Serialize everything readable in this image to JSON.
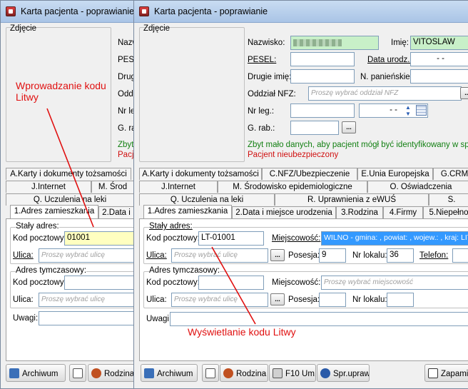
{
  "back_window": {
    "title": "Karta pacjenta - poprawianie",
    "photo_label": "Zdjęcie",
    "labels": {
      "nazwisko": "Nazwis",
      "pesel": "PESE",
      "drugie": "Drugie",
      "oddzial": "Oddzi",
      "nr_leg": "Nr leg",
      "g_rab": "G. rab"
    },
    "msg_green": "Zbyt",
    "msg_red": "Pacjen",
    "tabs_row1": [
      "A.Karty i dokumenty tożsamości",
      ""
    ],
    "tabs_row2": [
      "J.Internet",
      "M. Środ"
    ],
    "tabs_row3": [
      "Q. Uczulenia na leki"
    ],
    "tabs_row4": [
      "1.Adres zamieszkania",
      "2.Data i"
    ],
    "staly_adres": "Stały adres:",
    "kod_pocztowy_label": "Kod pocztowy:",
    "kod_pocztowy_value": "01001",
    "ulica_label": "Ulica:",
    "ulica_placeholder": "Proszę wybrać ulicę",
    "adres_tymczasowy": "Adres tymczasowy:",
    "uwagi_label": "Uwagi:",
    "buttons": {
      "archiwum": "Archiwum",
      "rodzina": "Rodzina"
    }
  },
  "front_window": {
    "title": "Karta pacjenta - poprawianie",
    "photo_label": "Zdjęcie",
    "nazwisko_label": "Nazwisko:",
    "imie_label": "Imię:",
    "imie_value": "VITOSLAW",
    "pesel_label": "PESEL:",
    "data_urodz_label": "Data urodz.:",
    "data_urodz_value": "-   -",
    "drugie_imie_label": "Drugie imię:",
    "n_panienskie_label": "N. panieńskie:",
    "oddzial_label": "Oddział NFZ:",
    "oddzial_placeholder": "Proszę wybrać oddział NFZ",
    "nr_leg_label": "Nr leg.:",
    "nr_leg_date": "-   -",
    "g_rab_label": "G. rab.:",
    "msg_green": "Zbyt mało danych, aby pacjent mógł być identyfikowany w spraw",
    "msg_red": "Pacjent nieubezpieczony",
    "tabs_row1": [
      "A.Karty i dokumenty tożsamości",
      "C.NFZ/Ubezpieczenie",
      "E.Unia Europejska",
      "G.CRM"
    ],
    "tabs_row2": [
      "J.Internet",
      "M. Środowisko epidemiologiczne",
      "O. Oświadczenia"
    ],
    "tabs_row3": [
      "Q. Uczulenia na leki",
      "R. Uprawnienia z eWUŚ",
      "S."
    ],
    "tabs_row4": [
      "1.Adres zamieszkania",
      "2.Data i miejsce urodzenia",
      "3.Rodzina",
      "4.Firmy",
      "5.Niepełno"
    ],
    "staly_adres": "Stały adres:",
    "kod_pocztowy_label": "Kod pocztowy:",
    "kod_pocztowy_value": "LT-01001",
    "miejscowosc_label": "Miejscowość:",
    "miejscowosc_value": "WILNO - gmina: , powiat: , wojew.: , kraj: LIT",
    "ulica_label": "Ulica:",
    "ulica_placeholder": "Proszę wybrać ulicę",
    "posesja_label": "Posesja:",
    "posesja_value": "9",
    "nr_lokalu_label": "Nr lokalu:",
    "nr_lokalu_value": "36",
    "telefon_label": "Telefon:",
    "adres_tymczasowy": "Adres tymczasowy:",
    "miejscowosc_placeholder": "Proszę wybrać miejscowość",
    "uwagi_label": "Uwagi:",
    "buttons": {
      "archiwum": "Archiwum",
      "rodzina": "Rodzina",
      "f10": "F10 Um.",
      "spr": "Spr.upraw.",
      "zapami": "Zapami"
    }
  },
  "annotations": {
    "top": "Wprowadzanie kodu\nLitwy",
    "bottom": "Wyświetlanie kodu Litwy",
    "color": "#e01010"
  },
  "colors": {
    "highlight_yellow": "#ffffc0",
    "nazwisko_green": "#c8f0c8",
    "miejscowosc_blue": "#3399ff"
  }
}
